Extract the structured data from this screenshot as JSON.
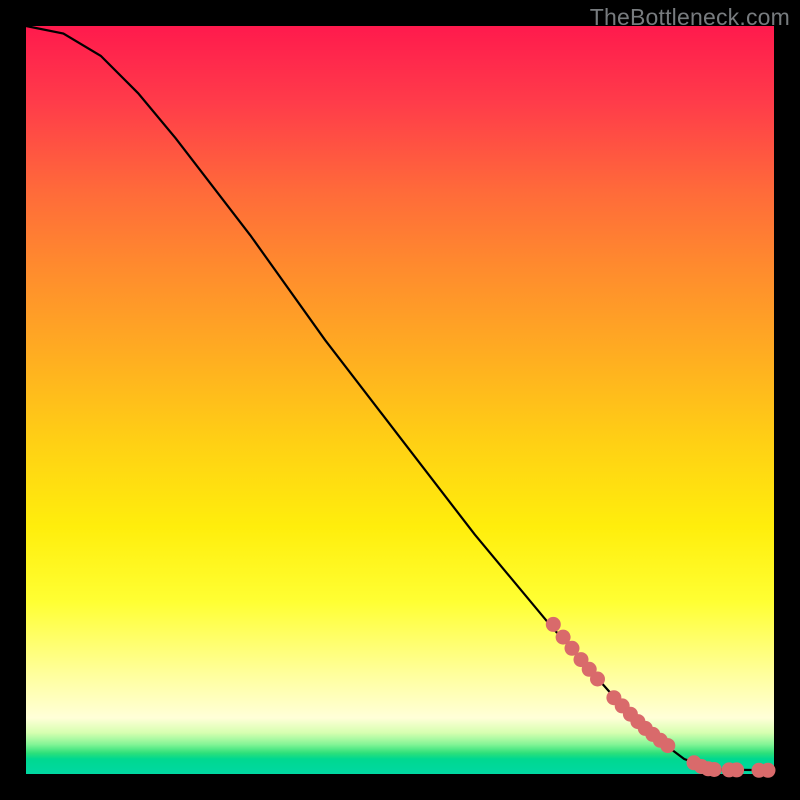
{
  "watermark": "TheBottleneck.com",
  "chart_data": {
    "type": "line",
    "title": "",
    "xlabel": "",
    "ylabel": "",
    "xlim": [
      0,
      100
    ],
    "ylim": [
      0,
      100
    ],
    "curve": [
      {
        "x": 0,
        "y": 100
      },
      {
        "x": 5,
        "y": 99
      },
      {
        "x": 10,
        "y": 96
      },
      {
        "x": 15,
        "y": 91
      },
      {
        "x": 20,
        "y": 85
      },
      {
        "x": 30,
        "y": 72
      },
      {
        "x": 40,
        "y": 58
      },
      {
        "x": 50,
        "y": 45
      },
      {
        "x": 60,
        "y": 32
      },
      {
        "x": 70,
        "y": 20
      },
      {
        "x": 78,
        "y": 11
      },
      {
        "x": 84,
        "y": 5
      },
      {
        "x": 88,
        "y": 2
      },
      {
        "x": 92,
        "y": 0.6
      },
      {
        "x": 100,
        "y": 0.5
      }
    ],
    "markers": [
      {
        "x": 70.5,
        "y": 20.0
      },
      {
        "x": 71.8,
        "y": 18.3
      },
      {
        "x": 73.0,
        "y": 16.8
      },
      {
        "x": 74.2,
        "y": 15.3
      },
      {
        "x": 75.3,
        "y": 14.0
      },
      {
        "x": 76.4,
        "y": 12.7
      },
      {
        "x": 78.6,
        "y": 10.2
      },
      {
        "x": 79.7,
        "y": 9.1
      },
      {
        "x": 80.8,
        "y": 8.0
      },
      {
        "x": 81.8,
        "y": 7.0
      },
      {
        "x": 82.8,
        "y": 6.1
      },
      {
        "x": 83.8,
        "y": 5.3
      },
      {
        "x": 84.8,
        "y": 4.5
      },
      {
        "x": 85.8,
        "y": 3.8
      },
      {
        "x": 89.3,
        "y": 1.5
      },
      {
        "x": 90.3,
        "y": 1.0
      },
      {
        "x": 91.2,
        "y": 0.7
      },
      {
        "x": 92.0,
        "y": 0.6
      },
      {
        "x": 94.0,
        "y": 0.55
      },
      {
        "x": 95.0,
        "y": 0.55
      },
      {
        "x": 98.0,
        "y": 0.5
      },
      {
        "x": 99.2,
        "y": 0.5
      }
    ],
    "marker_color": "#d96a6b",
    "marker_radius": 7.5
  }
}
